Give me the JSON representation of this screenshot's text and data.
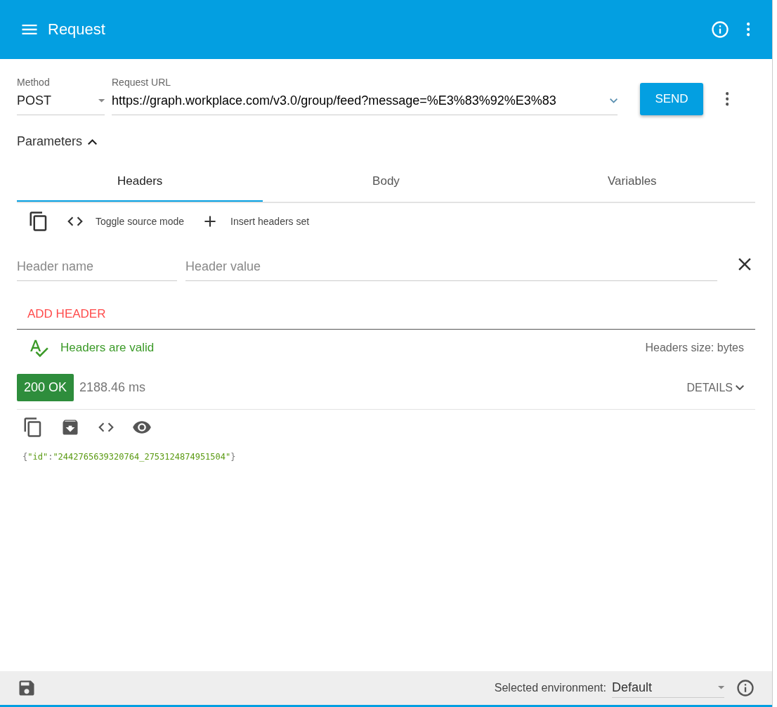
{
  "app_bar": {
    "title": "Request"
  },
  "request": {
    "method_label": "Method",
    "method": "POST",
    "url_label": "Request URL",
    "url": "https://graph.workplace.com/v3.0/group/feed?message=%E3%83%92%E3%83",
    "send": "SEND"
  },
  "parameters": {
    "title": "Parameters",
    "expanded": true
  },
  "tabs": [
    {
      "label": "Headers",
      "selected": true
    },
    {
      "label": "Body",
      "selected": false
    },
    {
      "label": "Variables",
      "selected": false
    }
  ],
  "headers_toolbar": [
    {
      "kind": "copy"
    },
    {
      "kind": "code",
      "label": "Toggle source mode"
    },
    {
      "kind": "add",
      "label": "Insert headers set"
    }
  ],
  "header_rows": [
    {
      "name_placeholder": "Header name",
      "value_placeholder": "Header value"
    }
  ],
  "add_header": "ADD HEADER",
  "validation": {
    "valid": true,
    "message": "Headers are valid",
    "size": "Headers size: bytes"
  },
  "response": {
    "status": "200 OK",
    "time": "2188.46 ms",
    "details": "DETAILS",
    "body": [
      {
        "kind": "punct",
        "text": "{"
      },
      {
        "kind": "string",
        "text": "\"id\""
      },
      {
        "kind": "punct",
        "text": ":"
      },
      {
        "kind": "string",
        "text": "\"2442765639320764_2753124874951504\""
      },
      {
        "kind": "punct",
        "text": "}"
      }
    ]
  },
  "footer": {
    "env_label": "Selected environment:",
    "env": "Default"
  }
}
